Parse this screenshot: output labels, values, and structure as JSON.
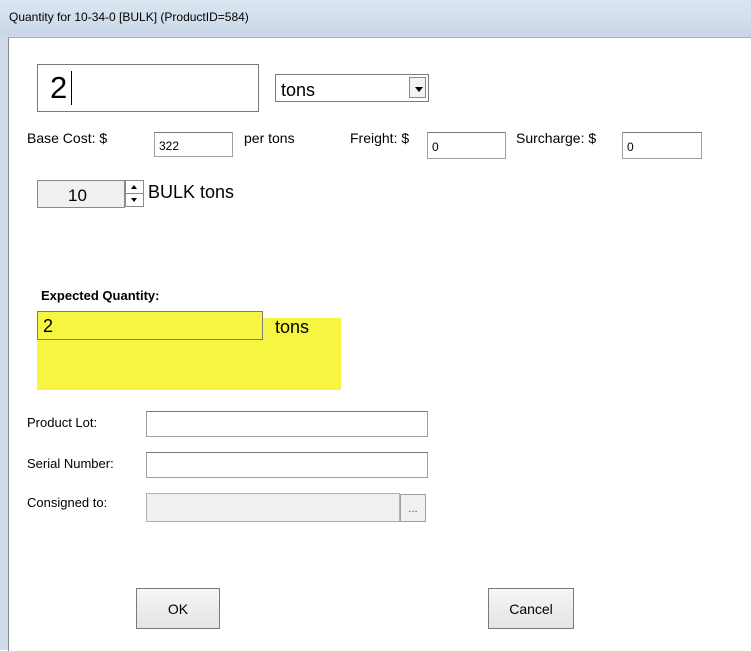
{
  "window": {
    "title": "Quantity for 10-34-0  [BULK] (ProductID=584)"
  },
  "quantity": {
    "value": "2",
    "unit_selected": "tons"
  },
  "cost": {
    "base_label": "Base Cost: $",
    "base_value": "322",
    "per_label": "per tons",
    "freight_label": "Freight: $",
    "freight_value": "0",
    "surcharge_label": "Surcharge: $",
    "surcharge_value": "0"
  },
  "bulk": {
    "spin_value": "10",
    "label": "BULK tons"
  },
  "expected": {
    "label": "Expected Quantity:",
    "value": "2",
    "unit": "tons",
    "highlight_color": "#f5f542"
  },
  "fields": {
    "product_lot_label": "Product Lot:",
    "product_lot_value": "",
    "serial_number_label": "Serial Number:",
    "serial_number_value": "",
    "consigned_to_label": "Consigned to:",
    "consigned_to_value": "",
    "browse_label": "..."
  },
  "buttons": {
    "ok": "OK",
    "cancel": "Cancel"
  }
}
